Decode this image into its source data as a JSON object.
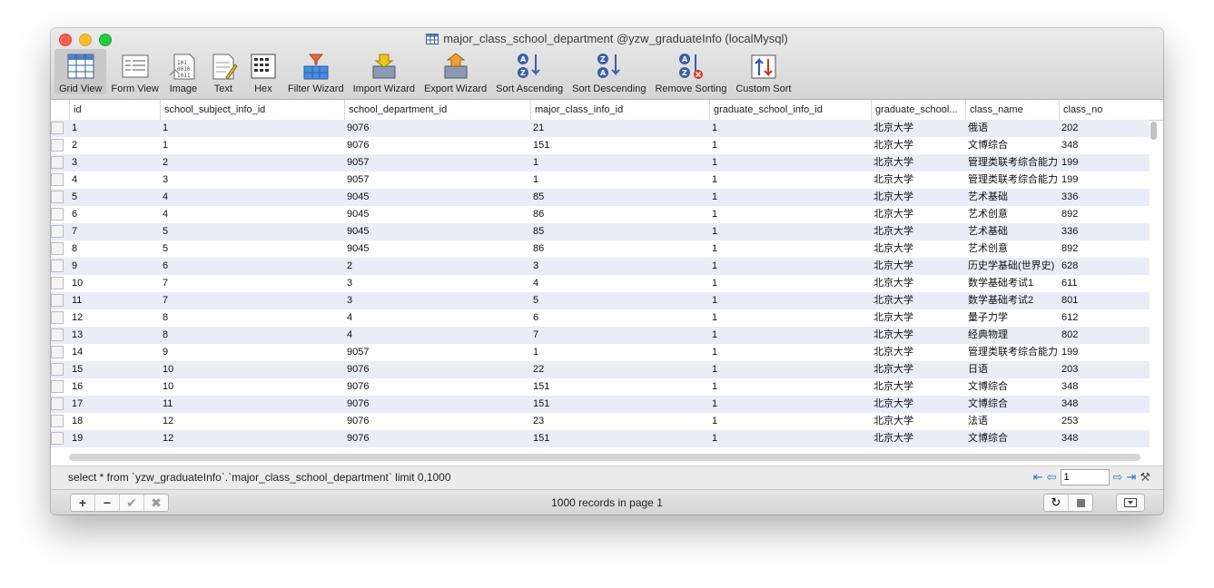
{
  "window": {
    "title": "major_class_school_department @yzw_graduateInfo (localMysql)"
  },
  "toolbar": {
    "items": [
      {
        "label": "Grid View",
        "icon": "grid-view-icon"
      },
      {
        "label": "Form View",
        "icon": "form-view-icon"
      },
      {
        "label": "Image",
        "icon": "image-icon"
      },
      {
        "label": "Text",
        "icon": "text-icon"
      },
      {
        "label": "Hex",
        "icon": "hex-icon"
      },
      {
        "label": "Filter Wizard",
        "icon": "filter-wizard-icon"
      },
      {
        "label": "Import Wizard",
        "icon": "import-wizard-icon"
      },
      {
        "label": "Export Wizard",
        "icon": "export-wizard-icon"
      },
      {
        "label": "Sort Ascending",
        "icon": "sort-ascending-icon"
      },
      {
        "label": "Sort Descending",
        "icon": "sort-descending-icon"
      },
      {
        "label": "Remove Sorting",
        "icon": "remove-sorting-icon"
      },
      {
        "label": "Custom Sort",
        "icon": "custom-sort-icon"
      }
    ]
  },
  "grid": {
    "columns": [
      "id",
      "school_subject_info_id",
      "school_department_id",
      "major_class_info_id",
      "graduate_school_info_id",
      "graduate_school...",
      "class_name",
      "class_no"
    ],
    "rows": [
      [
        "1",
        "1",
        "9076",
        "21",
        "1",
        "北京大学",
        "俄语",
        "202"
      ],
      [
        "2",
        "1",
        "9076",
        "151",
        "1",
        "北京大学",
        "文博综合",
        "348"
      ],
      [
        "3",
        "2",
        "9057",
        "1",
        "1",
        "北京大学",
        "管理类联考综合能力",
        "199"
      ],
      [
        "4",
        "3",
        "9057",
        "1",
        "1",
        "北京大学",
        "管理类联考综合能力",
        "199"
      ],
      [
        "5",
        "4",
        "9045",
        "85",
        "1",
        "北京大学",
        "艺术基础",
        "336"
      ],
      [
        "6",
        "4",
        "9045",
        "86",
        "1",
        "北京大学",
        "艺术创意",
        "892"
      ],
      [
        "7",
        "5",
        "9045",
        "85",
        "1",
        "北京大学",
        "艺术基础",
        "336"
      ],
      [
        "8",
        "5",
        "9045",
        "86",
        "1",
        "北京大学",
        "艺术创意",
        "892"
      ],
      [
        "9",
        "6",
        "2",
        "3",
        "1",
        "北京大学",
        "历史学基础(世界史)",
        "628"
      ],
      [
        "10",
        "7",
        "3",
        "4",
        "1",
        "北京大学",
        "数学基础考试1",
        "611"
      ],
      [
        "11",
        "7",
        "3",
        "5",
        "1",
        "北京大学",
        "数学基础考试2",
        "801"
      ],
      [
        "12",
        "8",
        "4",
        "6",
        "1",
        "北京大学",
        "量子力学",
        "612"
      ],
      [
        "13",
        "8",
        "4",
        "7",
        "1",
        "北京大学",
        "经典物理",
        "802"
      ],
      [
        "14",
        "9",
        "9057",
        "1",
        "1",
        "北京大学",
        "管理类联考综合能力",
        "199"
      ],
      [
        "15",
        "10",
        "9076",
        "22",
        "1",
        "北京大学",
        "日语",
        "203"
      ],
      [
        "16",
        "10",
        "9076",
        "151",
        "1",
        "北京大学",
        "文博综合",
        "348"
      ],
      [
        "17",
        "11",
        "9076",
        "151",
        "1",
        "北京大学",
        "文博综合",
        "348"
      ],
      [
        "18",
        "12",
        "9076",
        "23",
        "1",
        "北京大学",
        "法语",
        "253"
      ],
      [
        "19",
        "12",
        "9076",
        "151",
        "1",
        "北京大学",
        "文博综合",
        "348"
      ]
    ]
  },
  "status": {
    "sql": "select * from `yzw_graduateInfo`.`major_class_school_department` limit 0,1000",
    "page_value": "1",
    "records": "1000 records in page 1"
  }
}
